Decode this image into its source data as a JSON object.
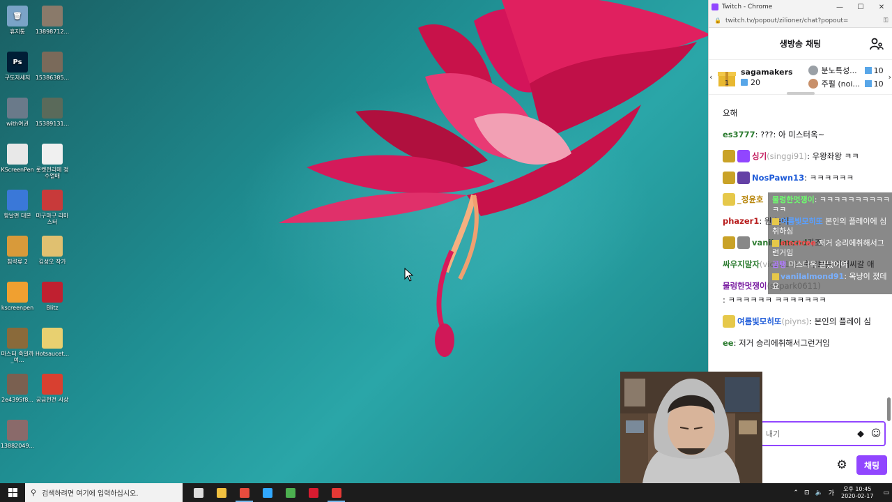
{
  "desktop": {
    "icons": [
      {
        "label": "휴지통",
        "color": "#7aa3c7",
        "glyph": "🗑"
      },
      {
        "label": "13898712...",
        "color": "#8a7a6a",
        "glyph": ""
      },
      {
        "label": "구도자세지",
        "color": "#001e36",
        "glyph": "Ps"
      },
      {
        "label": "15386385...",
        "color": "#7a6a5a",
        "glyph": ""
      },
      {
        "label": "with여권",
        "color": "#6a7a8a",
        "glyph": ""
      },
      {
        "label": "15389131...",
        "color": "#5a6a5a",
        "glyph": ""
      },
      {
        "label": "KScreenPen",
        "color": "#e8e8e8",
        "glyph": ""
      },
      {
        "label": "롯켓전리메 정수열매",
        "color": "#f0f0f0",
        "glyph": ""
      },
      {
        "label": "항날편 대본",
        "color": "#3a78d8",
        "glyph": ""
      },
      {
        "label": "마구마구 리마스터",
        "color": "#c83a3a",
        "glyph": ""
      },
      {
        "label": "침략류 2",
        "color": "#d89a3a",
        "glyph": ""
      },
      {
        "label": "김성오 작가",
        "color": "#e0c070",
        "glyph": ""
      },
      {
        "label": "kscreenpen",
        "color": "#f0a030",
        "glyph": ""
      },
      {
        "label": "Blitz",
        "color": "#c02030",
        "glyph": ""
      },
      {
        "label": "마스터 죽일까_여...",
        "color": "#8a6a3a",
        "glyph": ""
      },
      {
        "label": "Hotsaucet...",
        "color": "#e8d070",
        "glyph": ""
      },
      {
        "label": "2e4395f8...",
        "color": "#7a6050",
        "glyph": ""
      },
      {
        "label": "궁금전전 시상",
        "color": "#d84030",
        "glyph": ""
      },
      {
        "label": "13882049...",
        "color": "#8a6a6a",
        "glyph": ""
      }
    ]
  },
  "browser": {
    "title": "Twitch - Chrome",
    "url": "twitch.tv/popout/zilioner/chat?popout=",
    "minimize": "—",
    "maximize": "☐",
    "close": "✕"
  },
  "chat": {
    "title": "생방송 채팅",
    "gifts": {
      "top_name": "sagamakers",
      "top_count": "20",
      "side": [
        {
          "name": "분노특성...",
          "count": "10",
          "medal": "#9aa0a6"
        },
        {
          "name": "주펄 (noi...",
          "count": "10",
          "medal": "#c8906a"
        }
      ]
    },
    "messages": [
      {
        "badges": [],
        "user": "",
        "login": "",
        "color": "#18181b",
        "text": "요해"
      },
      {
        "badges": [],
        "user": "es3777",
        "login": "",
        "color": "#2e7d32",
        "text": ": ???: 아 미스터옥~"
      },
      {
        "badges": [
          "#c9a227",
          "#9146ff"
        ],
        "user": "싱기",
        "login": " (singgi91)",
        "color": "#c2185b",
        "text": ": 우왕좌왕 ㅋㅋ"
      },
      {
        "badges": [
          "#c9a227",
          "#6441a5"
        ],
        "user": "NosPawn13",
        "login": "",
        "color": "#1e5bd8",
        "text": ": ㅋㅋㅋㅋㅋㅋ"
      },
      {
        "badges": [
          "#e6c84a"
        ],
        "user": "_정윤호",
        "login": "",
        "color": "#b8860b",
        "text": ""
      },
      {
        "badges": [],
        "user": "phazer1",
        "login": "",
        "color": "#b71c1c",
        "text": ": 원 는데"
      },
      {
        "badges": [
          "#c9a227",
          "#888888"
        ],
        "user": "vanilalmond",
        "login": "",
        "color": "#2e7d32",
        "text": " 가죠"
      },
      {
        "badges": [],
        "user": "싸우지말자",
        "login": " (vic2015)",
        "color": "#2e7d32",
        "text": ": 축구보는 아저씨갈 애"
      },
      {
        "badges": [],
        "user": "물렁한멋쟁이",
        "login": " (sbpark0611)",
        "color": "#7b1fa2",
        "text": ": ㅋㅋㅋㅋㅋㅋ ㅋㅋㅋㅋㅋㅋㅋ"
      },
      {
        "badges": [
          "#e6c84a"
        ],
        "user": "여름빛모히또",
        "login": " (piyns)",
        "color": "#1e5bd8",
        "text": ": 본인의 플레이 심"
      },
      {
        "badges": [],
        "user": "ee",
        "login": "",
        "color": "#2e7d32",
        "text": ": 저거 승리에취해서그런거임"
      }
    ],
    "input_placeholder": "채팅 보내기",
    "input_visible": "내기",
    "send_label": "채팅"
  },
  "overlay": {
    "lines": [
      {
        "user": "물렁한멋쟁이",
        "color": "#6dff6d",
        "text": ": ㅋㅋㅋㅋㅋㅋㅋㅋㅋㅋㅋㅋ",
        "badge": false
      },
      {
        "user": "여름빛모히또",
        "color": "#5aa0ff",
        "text": " 본인의 플레이에 심취하심",
        "badge": true
      },
      {
        "user": "electree",
        "color": "#ff4a4a",
        "text": " 저거 승리에취해서그런거임",
        "badge": true
      },
      {
        "user": "곰탱",
        "color": "#b07aff",
        "text": " 미스터옥 끝났어여",
        "badge": false
      },
      {
        "user": "vanilalmond91",
        "color": "#7ab0ff",
        "text": ": 옥냥이 졌데요",
        "badge": true
      }
    ]
  },
  "taskbar": {
    "search_placeholder": "검색하려면 여기에 입력하십시오.",
    "apps": [
      {
        "name": "task-view",
        "color": "#dddddd",
        "active": false
      },
      {
        "name": "file-explorer",
        "color": "#f0c040",
        "active": false
      },
      {
        "name": "chrome",
        "color": "#e84c3d",
        "active": true
      },
      {
        "name": "photoshop",
        "color": "#31a8ff",
        "active": false
      },
      {
        "name": "app-green",
        "color": "#4caf50",
        "active": false
      },
      {
        "name": "blitz",
        "color": "#d81b30",
        "active": false
      },
      {
        "name": "app-red",
        "color": "#e53935",
        "active": true
      }
    ],
    "ime": "가",
    "time": "오후 10:45",
    "date": "2020-02-17"
  }
}
